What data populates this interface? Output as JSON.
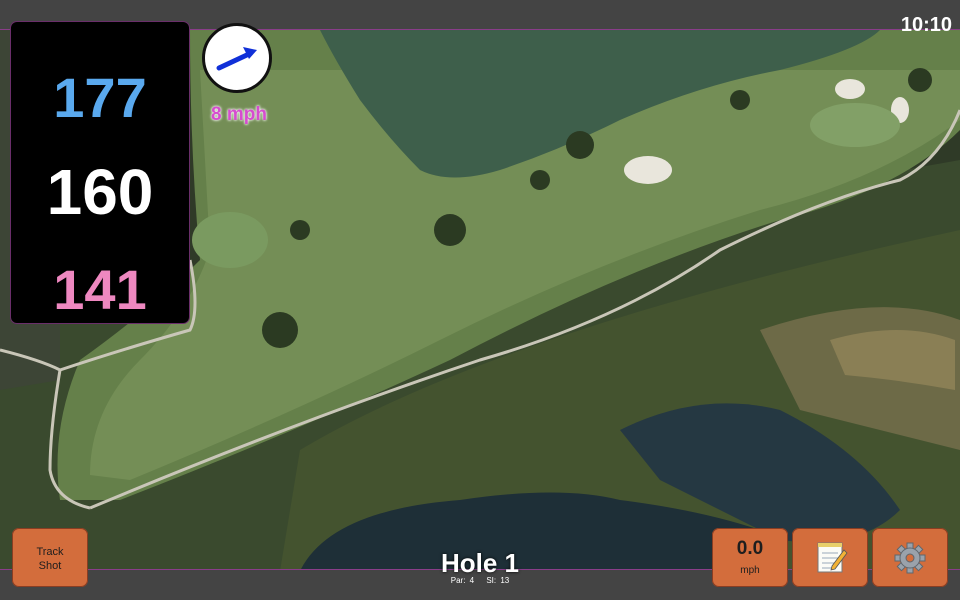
{
  "status": {
    "time": "10:10"
  },
  "yardages": {
    "back": "177",
    "middle": "160",
    "front": "141"
  },
  "wind": {
    "speed_label": "8 mph",
    "icon": "wind-arrow-icon"
  },
  "hole": {
    "title": "Hole 1",
    "par": "Par: 4",
    "stroke_index": "SI: 13"
  },
  "buttons": {
    "track_shot": [
      "Track",
      "Shot"
    ],
    "speed": {
      "value": "0.0",
      "unit": "mph"
    },
    "notes_icon": "notepad-icon",
    "settings_icon": "gear-icon"
  },
  "colors": {
    "back_yardage": "#5aa9ee",
    "middle_yardage": "#ffffff",
    "front_yardage": "#ee88c0",
    "wind_text": "#d64ccf",
    "button": "#d36d3c"
  }
}
